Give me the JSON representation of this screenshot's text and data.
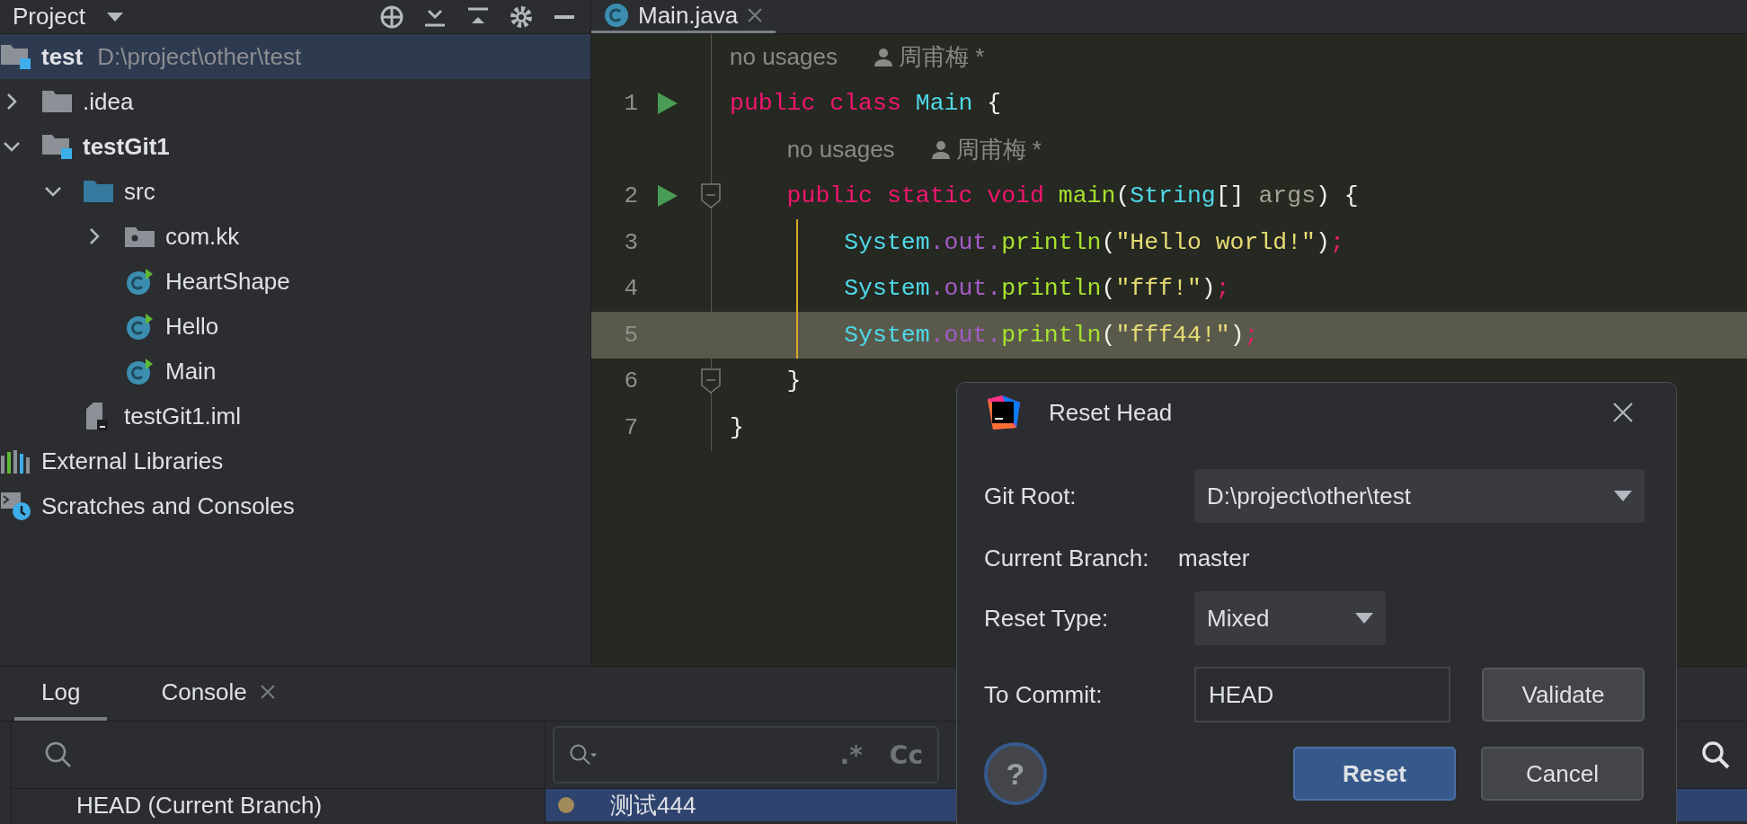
{
  "project_panel": {
    "title": "Project",
    "tree": [
      {
        "kind": "module",
        "label": "test",
        "detail": "D:\\project\\other\\test",
        "selected": true,
        "children": [
          {
            "kind": "folder",
            "label": ".idea",
            "expanded": false,
            "selected": false
          },
          {
            "kind": "module",
            "label": "testGit1",
            "expanded": true,
            "selected": false,
            "children": [
              {
                "kind": "source-folder",
                "label": "src",
                "expanded": true,
                "selected": false,
                "children": [
                  {
                    "kind": "package",
                    "label": "com.kk",
                    "expanded": false,
                    "selected": false
                  },
                  {
                    "kind": "class",
                    "label": "HeartShape",
                    "selected": false
                  },
                  {
                    "kind": "class",
                    "label": "Hello",
                    "selected": false
                  },
                  {
                    "kind": "class",
                    "label": "Main",
                    "selected": false
                  }
                ]
              },
              {
                "kind": "iml",
                "label": "testGit1.iml",
                "selected": false
              }
            ]
          }
        ]
      },
      {
        "kind": "libraries",
        "label": "External Libraries",
        "selected": false
      },
      {
        "kind": "scratches",
        "label": "Scratches and Consoles",
        "selected": false
      }
    ]
  },
  "editor": {
    "tab": "Main.java",
    "lines": [
      {
        "kind": "hint",
        "usages": "no usages",
        "author": "周甫梅 *"
      },
      {
        "kind": "code",
        "number": "1",
        "run": true,
        "fold": false,
        "changed": false,
        "highlighted": false,
        "tokens": [
          {
            "kind": "keyword",
            "s": "public class "
          },
          {
            "kind": "type",
            "s": "Main "
          },
          {
            "kind": "punct",
            "s": "{"
          }
        ]
      },
      {
        "kind": "hint",
        "usages": "no usages",
        "author": "周甫梅 *"
      },
      {
        "kind": "code",
        "number": "2",
        "run": true,
        "fold": true,
        "changed": false,
        "highlighted": false,
        "tokens": [
          {
            "kind": "keyword",
            "s": "    public static void "
          },
          {
            "kind": "method",
            "s": "main"
          },
          {
            "kind": "punct",
            "s": "("
          },
          {
            "kind": "type",
            "s": "String"
          },
          {
            "kind": "punct",
            "s": "[] "
          },
          {
            "kind": "param",
            "s": "args"
          },
          {
            "kind": "punct",
            "s": ") {"
          }
        ]
      },
      {
        "kind": "code",
        "number": "3",
        "run": false,
        "fold": false,
        "changed": true,
        "highlighted": false,
        "tokens": [
          {
            "kind": "type",
            "s": "        System"
          },
          {
            "kind": "field",
            "s": ".out."
          },
          {
            "kind": "method",
            "s": "println"
          },
          {
            "kind": "punct",
            "s": "("
          },
          {
            "kind": "string",
            "s": "\"Hello world!\""
          },
          {
            "kind": "punct",
            "s": ")"
          },
          {
            "kind": "semi",
            "s": ";"
          }
        ]
      },
      {
        "kind": "code",
        "number": "4",
        "run": false,
        "fold": false,
        "changed": true,
        "highlighted": false,
        "tokens": [
          {
            "kind": "type",
            "s": "        System"
          },
          {
            "kind": "field",
            "s": ".out."
          },
          {
            "kind": "method",
            "s": "println"
          },
          {
            "kind": "punct",
            "s": "("
          },
          {
            "kind": "string",
            "s": "\"fff!\""
          },
          {
            "kind": "punct",
            "s": ")"
          },
          {
            "kind": "semi",
            "s": ";"
          }
        ]
      },
      {
        "kind": "code",
        "number": "5",
        "run": false,
        "fold": false,
        "changed": true,
        "highlighted": true,
        "tokens": [
          {
            "kind": "type",
            "s": "        System"
          },
          {
            "kind": "field",
            "s": ".out."
          },
          {
            "kind": "method",
            "s": "println"
          },
          {
            "kind": "punct",
            "s": "("
          },
          {
            "kind": "string",
            "s": "\"fff44!\""
          },
          {
            "kind": "punct",
            "s": ")"
          },
          {
            "kind": "semi",
            "s": ";"
          }
        ]
      },
      {
        "kind": "code",
        "number": "6",
        "run": false,
        "fold": true,
        "changed": false,
        "highlighted": false,
        "tokens": [
          {
            "kind": "punct",
            "s": "    }"
          }
        ]
      },
      {
        "kind": "code",
        "number": "7",
        "run": false,
        "fold": false,
        "changed": false,
        "highlighted": false,
        "tokens": [
          {
            "kind": "punct",
            "s": "}"
          }
        ]
      }
    ]
  },
  "bottom_panel": {
    "tabs": [
      {
        "label": "Log",
        "selected": true,
        "closable": false
      },
      {
        "label": "Console",
        "selected": false,
        "closable": true
      }
    ],
    "branches": [
      {
        "label": "HEAD (Current Branch)"
      }
    ],
    "filter_options": [
      ".*",
      "Cc"
    ],
    "commits": [
      {
        "message": "测试444",
        "selected": true,
        "color": "#a08a5a"
      }
    ]
  },
  "dialog": {
    "title": "Reset Head",
    "rows": [
      {
        "kind": "dropdown",
        "label": "Git Root:",
        "value": "D:\\project\\other\\test",
        "wide": true
      },
      {
        "kind": "text",
        "label": "Current Branch:",
        "value": "master"
      },
      {
        "kind": "dropdown",
        "label": "Reset Type:",
        "value": "Mixed",
        "wide": false
      },
      {
        "kind": "input",
        "label": "To Commit:",
        "value": "HEAD",
        "button": {
          "label": "Validate"
        }
      }
    ],
    "help": "?",
    "buttons": [
      {
        "label": "Reset",
        "primary": true
      },
      {
        "label": "Cancel",
        "primary": false
      }
    ]
  }
}
